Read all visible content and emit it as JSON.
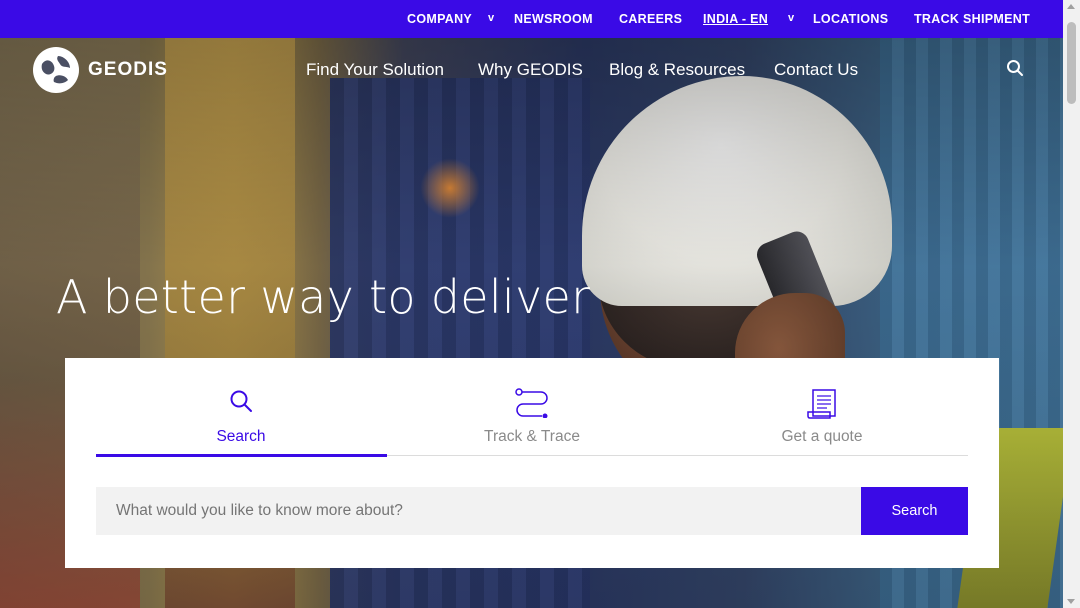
{
  "topbar": {
    "company": "COMPANY",
    "newsroom": "NEWSROOM",
    "careers": "CAREERS",
    "region": "INDIA - EN",
    "locations": "LOCATIONS",
    "track_shipment": "TRACK SHIPMENT",
    "chevron": "v"
  },
  "brand": {
    "name": "GEODIS",
    "accent_color": "#3a0ae6"
  },
  "nav": {
    "items": [
      {
        "label": "Find Your Solution"
      },
      {
        "label": "Why GEODIS"
      },
      {
        "label": "Blog & Resources"
      },
      {
        "label": "Contact Us"
      }
    ],
    "search_icon": "search-icon"
  },
  "hero": {
    "headline": "A better way to deliver"
  },
  "widget": {
    "tabs": [
      {
        "label": "Search",
        "icon": "search-icon",
        "active": true
      },
      {
        "label": "Track & Trace",
        "icon": "route-icon",
        "active": false
      },
      {
        "label": "Get a quote",
        "icon": "document-icon",
        "active": false
      }
    ],
    "input_placeholder": "What would you like to know more about?",
    "search_button": "Search"
  }
}
